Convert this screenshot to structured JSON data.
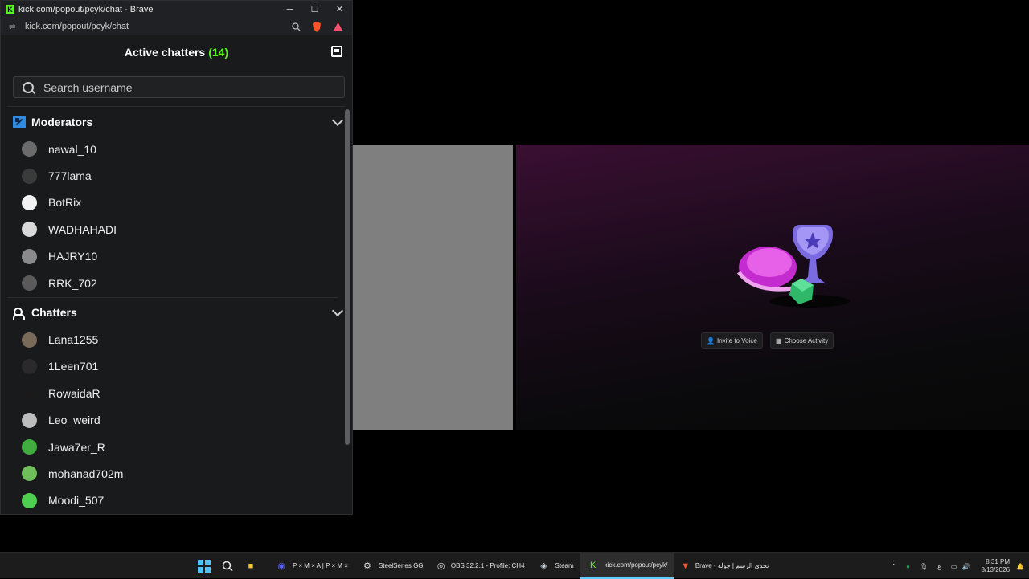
{
  "browser": {
    "window_title": "kick.com/popout/pcyk/chat - Brave",
    "url": "kick.com/popout/pcyk/chat",
    "logo_letter": "K",
    "controls": {
      "minimize": "─",
      "maximize": "☐",
      "close": "✕"
    }
  },
  "panel": {
    "title": "Active chatters",
    "count": "(14)",
    "search_placeholder": "Search username"
  },
  "sections": {
    "moderators": {
      "label": "Moderators",
      "users": [
        {
          "name": "nawal_10",
          "color": "#6b6b6b"
        },
        {
          "name": "777lama",
          "color": "#3b3b3b"
        },
        {
          "name": "BotRix",
          "color": "#f2f2f2"
        },
        {
          "name": "WADHAHADI",
          "color": "#d9d9d9"
        },
        {
          "name": "HAJRY10",
          "color": "#8a8a8a"
        },
        {
          "name": "RRK_702",
          "color": "#5a5a5a"
        }
      ]
    },
    "chatters": {
      "label": "Chatters",
      "users": [
        {
          "name": "Lana1255",
          "color": "#7a6a5a"
        },
        {
          "name": "1Leen701",
          "color": "#2a2a2a"
        },
        {
          "name": "RowaidaR",
          "color": "#1a1a1a"
        },
        {
          "name": "Leo_weird",
          "color": "#bdbdbd"
        },
        {
          "name": "Jawa7er_R",
          "color": "#3fae3f"
        },
        {
          "name": "mohanad702m",
          "color": "#6fbf5a"
        },
        {
          "name": "Moodi_507",
          "color": "#4fcf4f"
        }
      ]
    }
  },
  "activity": {
    "invite_label": "Invite to Voice",
    "choose_label": "Choose Activity"
  },
  "taskbar": {
    "items": [
      {
        "label": "P × M × A | P × M ×",
        "icon": "discord-icon"
      },
      {
        "label": "SteelSeries GG",
        "icon": "steelseries-icon"
      },
      {
        "label": "OBS 32.2.1 - Profile: CH4",
        "icon": "obs-icon"
      },
      {
        "label": "Steam",
        "icon": "steam-icon"
      },
      {
        "label": "kick.com/popout/pcyk/",
        "icon": "kick-icon"
      },
      {
        "label": "Brave - تحدي الرسم | جولة",
        "icon": "brave-icon"
      }
    ],
    "time": "8:31 PM",
    "date": "8/13/2026",
    "lang": "ع"
  },
  "colors": {
    "accent": "#53fc18",
    "moderator_icon": "#2f8ce0",
    "window_bg": "#181a1b"
  }
}
